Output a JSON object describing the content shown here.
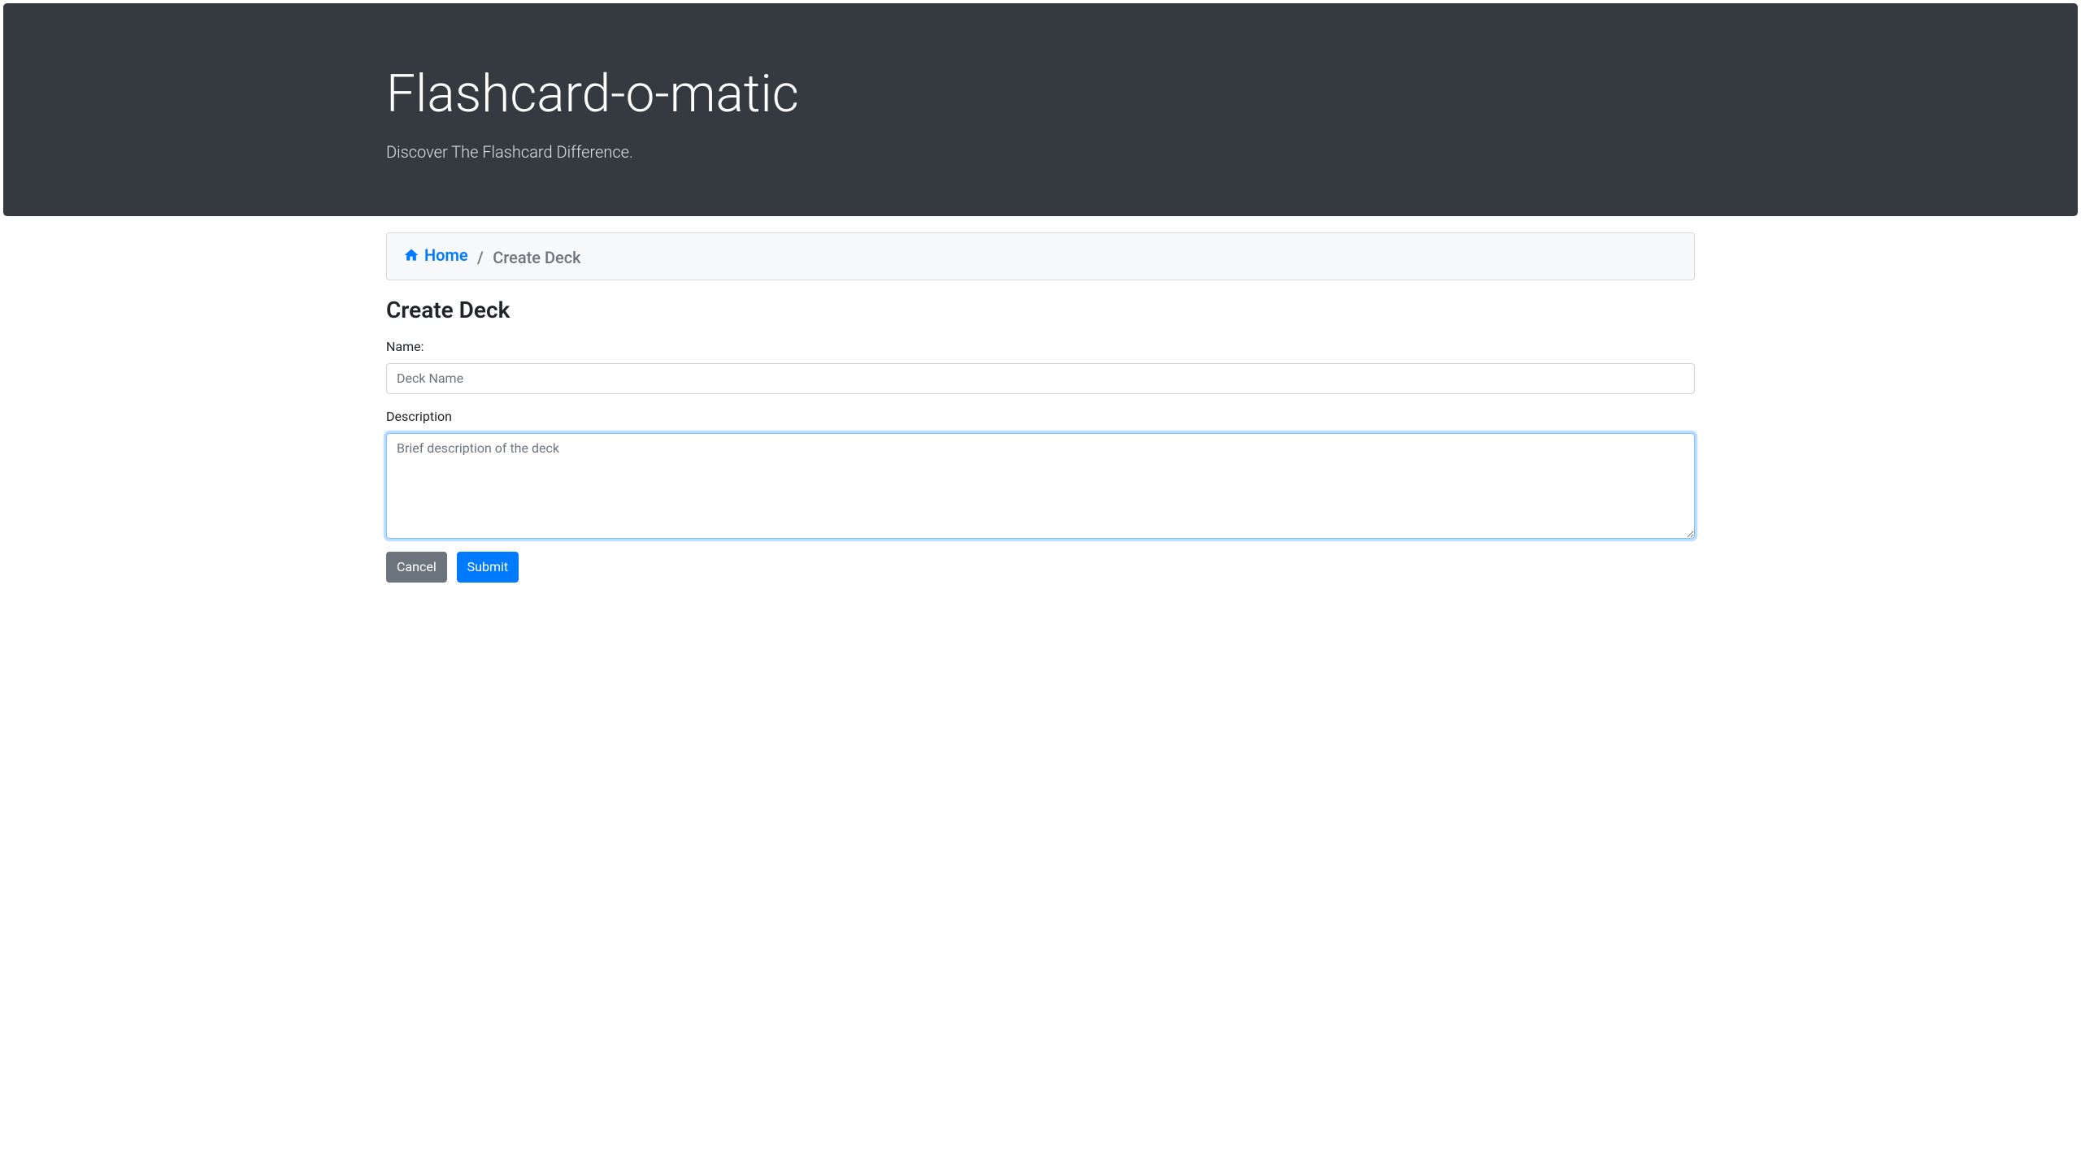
{
  "header": {
    "title": "Flashcard-o-matic",
    "tagline": "Discover The Flashcard Difference."
  },
  "breadcrumb": {
    "home_label": "Home",
    "separator": "/",
    "current": "Create Deck"
  },
  "page": {
    "title": "Create Deck"
  },
  "form": {
    "name_label": "Name:",
    "name_placeholder": "Deck Name",
    "name_value": "",
    "description_label": "Description",
    "description_placeholder": "Brief description of the deck",
    "description_value": "",
    "cancel_label": "Cancel",
    "submit_label": "Submit"
  }
}
